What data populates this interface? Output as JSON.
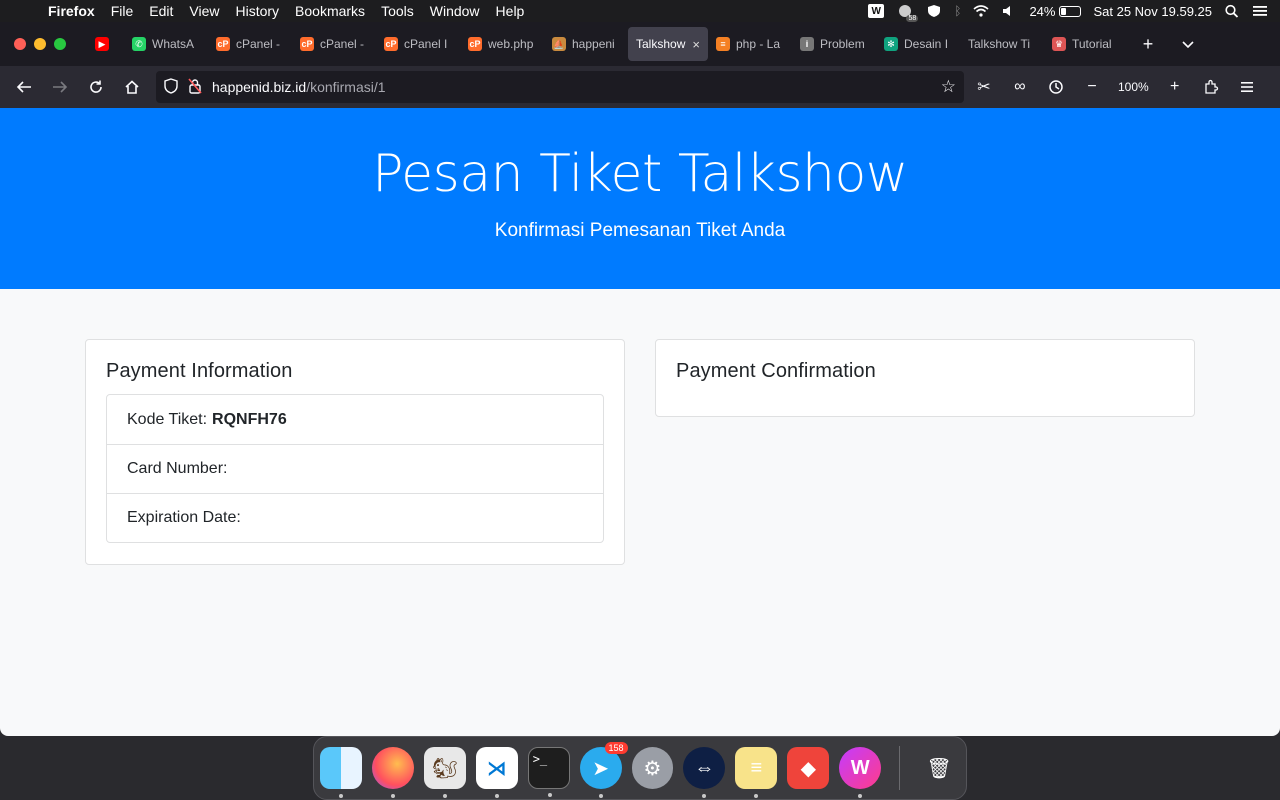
{
  "menubar": {
    "app": "Firefox",
    "items": [
      "File",
      "Edit",
      "View",
      "History",
      "Bookmarks",
      "Tools",
      "Window",
      "Help"
    ],
    "battery_pct": "24%",
    "battery_level": 0.24,
    "datetime": "Sat 25 Nov  19.59.25",
    "badge_count": "58"
  },
  "tabs": [
    {
      "label": "WhatsA",
      "icon": "whatsapp-icon",
      "color": "#25d366"
    },
    {
      "label": "cPanel -",
      "icon": "cpanel-icon",
      "color": "#ff6c2c"
    },
    {
      "label": "cPanel -",
      "icon": "cpanel-icon",
      "color": "#ff6c2c"
    },
    {
      "label": "cPanel I",
      "icon": "cpanel-icon",
      "color": "#ff6c2c"
    },
    {
      "label": "web.php",
      "icon": "cpanel-icon",
      "color": "#ff6c2c"
    },
    {
      "label": "happeni",
      "icon": "ship-icon",
      "color": "#c98a3e"
    },
    {
      "label": "Talkshow",
      "icon": "",
      "color": "",
      "active": true
    },
    {
      "label": "php - La",
      "icon": "stackoverflow-icon",
      "color": "#f48024"
    },
    {
      "label": "Problem",
      "icon": "info-icon",
      "color": "#777"
    },
    {
      "label": "Desain I",
      "icon": "openai-icon",
      "color": "#10a37f"
    },
    {
      "label": "Talkshow Ti",
      "icon": "",
      "color": ""
    },
    {
      "label": "Tutorial",
      "icon": "tutorial-icon",
      "color": "#d55"
    }
  ],
  "url": {
    "host": "happenid.biz.id",
    "path": "/konfirmasi/1"
  },
  "zoom": "100%",
  "page": {
    "title": "Pesan Tiket Talkshow",
    "subtitle": "Konfirmasi Pemesanan Tiket Anda",
    "payment_info": {
      "heading": "Payment Information",
      "kode_label": "Kode Tiket:",
      "kode_value": "RQNFH76",
      "card_label": "Card Number:",
      "exp_label": "Expiration Date:"
    },
    "payment_confirm": {
      "heading": "Payment Confirmation"
    }
  },
  "dock": {
    "apps": [
      "finder",
      "firefox",
      "sequel-ace",
      "vscode",
      "terminal",
      "telegram",
      "system-preferences",
      "teamviewer",
      "notes",
      "anydesk",
      "wps-office"
    ],
    "telegram_badge": "158"
  },
  "colors": {
    "brand": "#007bff",
    "page_bg": "#f8f9fa"
  }
}
